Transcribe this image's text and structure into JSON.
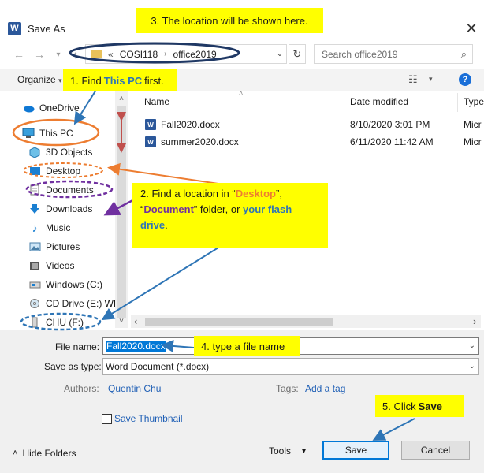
{
  "window": {
    "title": "Save As",
    "app_icon_letter": "W",
    "close_glyph": "✕"
  },
  "nav_buttons": {
    "back": "←",
    "forward": "→",
    "recent": "▾",
    "up": "↑"
  },
  "address": {
    "chevron": "«",
    "crumbs": [
      "COSI118",
      "office2019"
    ],
    "separator": "›",
    "dropdown": "⌄",
    "refresh": "↻"
  },
  "search": {
    "placeholder": "Search office2019",
    "icon": "⌕"
  },
  "toolbar": {
    "organize_label": "Organize",
    "organize_caret": "▾",
    "view_icon": "☷",
    "view_caret": "▾",
    "help": "?"
  },
  "sidebar": {
    "items": [
      {
        "label": "OneDrive",
        "icon": "cloud-icon"
      },
      {
        "label": "This PC",
        "icon": "computer-icon"
      },
      {
        "label": "3D Objects",
        "icon": "cube-icon"
      },
      {
        "label": "Desktop",
        "icon": "desktop-icon"
      },
      {
        "label": "Documents",
        "icon": "documents-icon"
      },
      {
        "label": "Downloads",
        "icon": "download-icon"
      },
      {
        "label": "Music",
        "icon": "music-icon"
      },
      {
        "label": "Pictures",
        "icon": "pictures-icon"
      },
      {
        "label": "Videos",
        "icon": "videos-icon"
      },
      {
        "label": "Windows (C:)",
        "icon": "drive-icon"
      },
      {
        "label": "CD Drive (E:) WD",
        "icon": "cd-icon"
      },
      {
        "label": "CHU (F:)",
        "icon": "usb-icon"
      }
    ],
    "scroll_up": "˄",
    "scroll_down": "˅"
  },
  "file_list": {
    "columns": [
      "Name",
      "Date modified",
      "Type"
    ],
    "rows": [
      {
        "name": "Fall2020.docx",
        "date": "8/10/2020 3:01 PM",
        "type": "Micr"
      },
      {
        "name": "summer2020.docx",
        "date": "6/11/2020 11:42 AM",
        "type": "Micr"
      }
    ],
    "sort_caret": "˄",
    "hscroll_left": "‹",
    "hscroll_right": "›"
  },
  "form": {
    "file_name_label": "File name:",
    "file_name_value": "Fall2020.docx",
    "save_type_label": "Save as type:",
    "save_type_value": "Word Document (*.docx)",
    "authors_label": "Authors:",
    "authors_value": "Quentin Chu",
    "tags_label": "Tags:",
    "tags_value": "Add a tag",
    "thumbnail_label": "Save Thumbnail",
    "dropdown_glyph": "⌄"
  },
  "footer": {
    "hide_folders_caret": "˄",
    "hide_folders_label": "Hide Folders",
    "tools_label": "Tools",
    "tools_caret": "▾",
    "save_label": "Save",
    "cancel_label": "Cancel"
  },
  "annotations": {
    "note1": {
      "prefix": "1. Find ",
      "highlight": "This PC",
      "suffix": " first."
    },
    "note2": {
      "line1_prefix": "2. Find a location in “",
      "line1_hl": "Desktop",
      "line1_suffix": "”,",
      "line2_prefix": "“",
      "line2_hl": "Document",
      "line2_mid": "” folder, or ",
      "line2_hl2": "your flash",
      "line3_hl": "drive",
      "line3_suffix": "."
    },
    "note3": "3. The location will be shown here.",
    "note4": "4. type a file name",
    "note5": {
      "prefix": "5. Click ",
      "bold": "Save"
    }
  },
  "colors": {
    "orange_ring": "#ed7d31",
    "purple_ring": "#7030a0",
    "blue_ring": "#2e75b6",
    "navy_ring": "#1f3864",
    "note_bg": "#ffff00",
    "red_arrow": "#c0504d"
  }
}
